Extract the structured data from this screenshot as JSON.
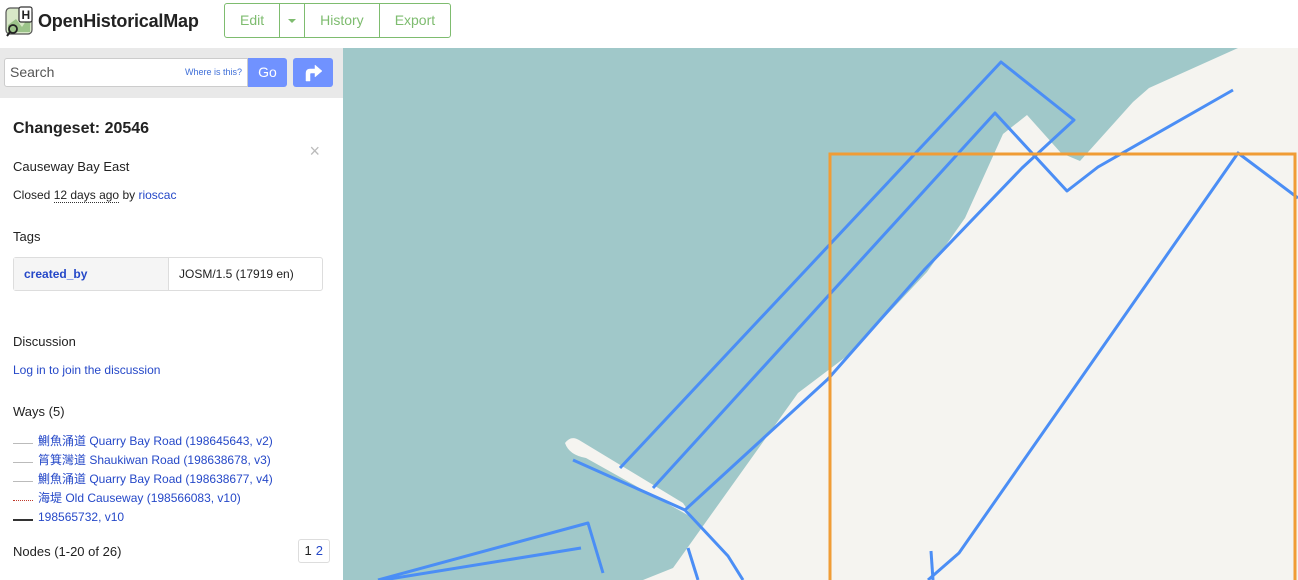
{
  "header": {
    "brand": "OpenHistoricalMap",
    "edit_label": "Edit",
    "history_label": "History",
    "export_label": "Export"
  },
  "search": {
    "placeholder": "Search",
    "where_label": "Where is this?",
    "go_label": "Go"
  },
  "changeset": {
    "title": "Changeset: 20546",
    "close_glyph": "×",
    "comment": "Causeway Bay East",
    "closed_prefix": "Closed",
    "closed_time": "12 days ago",
    "by_word": "by",
    "user": "rioscac"
  },
  "tags": {
    "heading": "Tags",
    "rows": [
      {
        "key": "created_by",
        "value": "JOSM/1.5 (17919 en)"
      }
    ]
  },
  "discussion": {
    "heading": "Discussion",
    "login_link": "Log in to join the discussion"
  },
  "ways": {
    "heading": "Ways (5)",
    "items": [
      {
        "label": "鰂魚涌道 Quarry Bay Road (198645643, v2)",
        "swatch": "#bbbbbb",
        "style": "solid"
      },
      {
        "label": "筲箕灣道 Shaukiwan Road (198638678, v3)",
        "swatch": "#bbbbbb",
        "style": "solid"
      },
      {
        "label": "鰂魚涌道 Quarry Bay Road (198638677, v4)",
        "swatch": "#bbbbbb",
        "style": "solid"
      },
      {
        "label": "海堤 Old Causeway (198566083, v10)",
        "swatch": "#c0392b",
        "style": "dotted"
      },
      {
        "label": "198565732, v10",
        "swatch": "#333333",
        "style": "solid"
      }
    ]
  },
  "nodes": {
    "heading": "Nodes (1-20 of 26)",
    "pages": [
      "1",
      "2"
    ]
  },
  "colors": {
    "accent_green": "#7ebc6f",
    "button_blue": "#7092ff",
    "water": "#a0c8c9",
    "land": "#f5f4f0",
    "changeset_outline": "#f09c35",
    "feature_line": "#4b8ef5"
  }
}
